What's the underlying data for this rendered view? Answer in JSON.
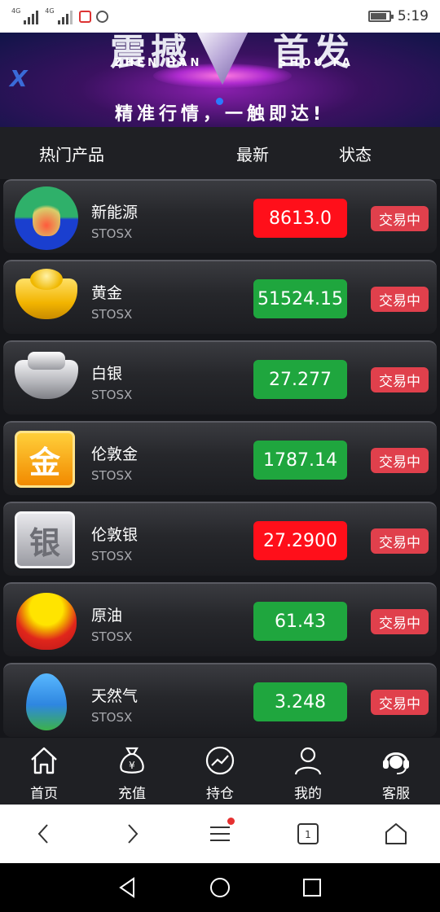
{
  "status_bar": {
    "network1": "4G",
    "network2": "4G",
    "time": "5:19",
    "battery_level": 0.85
  },
  "banner": {
    "big_left": "震撼",
    "big_right": "首发",
    "sub_left": "ZHEN HAN",
    "sub_right": "SHOU FA",
    "slogan": "精准行情，一触即达!"
  },
  "list_header": {
    "name_col": "热门产品",
    "latest_col": "最新",
    "status_col": "状态"
  },
  "products": [
    {
      "name": "新能源",
      "code": "STOSX",
      "price": "8613.0",
      "price_color": "#ff0f1a",
      "status": "交易中",
      "icon": "new-energy-icon"
    },
    {
      "name": "黄金",
      "code": "STOSX",
      "price": "51524.15",
      "price_color": "#1fa63e",
      "status": "交易中",
      "icon": "gold-ingot-icon"
    },
    {
      "name": "白银",
      "code": "STOSX",
      "price": "27.277",
      "price_color": "#1fa63e",
      "status": "交易中",
      "icon": "silver-ingot-icon"
    },
    {
      "name": "伦敦金",
      "code": "STOSX",
      "price": "1787.14",
      "price_color": "#1fa63e",
      "status": "交易中",
      "icon": "london-gold-icon",
      "icon_text": "金"
    },
    {
      "name": "伦敦银",
      "code": "STOSX",
      "price": "27.2900",
      "price_color": "#ff0f1a",
      "status": "交易中",
      "icon": "london-silver-icon",
      "icon_text": "银"
    },
    {
      "name": "原油",
      "code": "STOSX",
      "price": "61.43",
      "price_color": "#1fa63e",
      "status": "交易中",
      "icon": "crude-oil-icon"
    },
    {
      "name": "天然气",
      "code": "STOSX",
      "price": "3.248",
      "price_color": "#1fa63e",
      "status": "交易中",
      "icon": "natural-gas-icon"
    }
  ],
  "tabbar": [
    {
      "label": "首页",
      "icon": "home-icon"
    },
    {
      "label": "充值",
      "icon": "money-bag-icon"
    },
    {
      "label": "持仓",
      "icon": "chart-icon"
    },
    {
      "label": "我的",
      "icon": "user-icon"
    },
    {
      "label": "客服",
      "icon": "headset-icon"
    }
  ],
  "browser_bar": {
    "tab_count": "1"
  }
}
